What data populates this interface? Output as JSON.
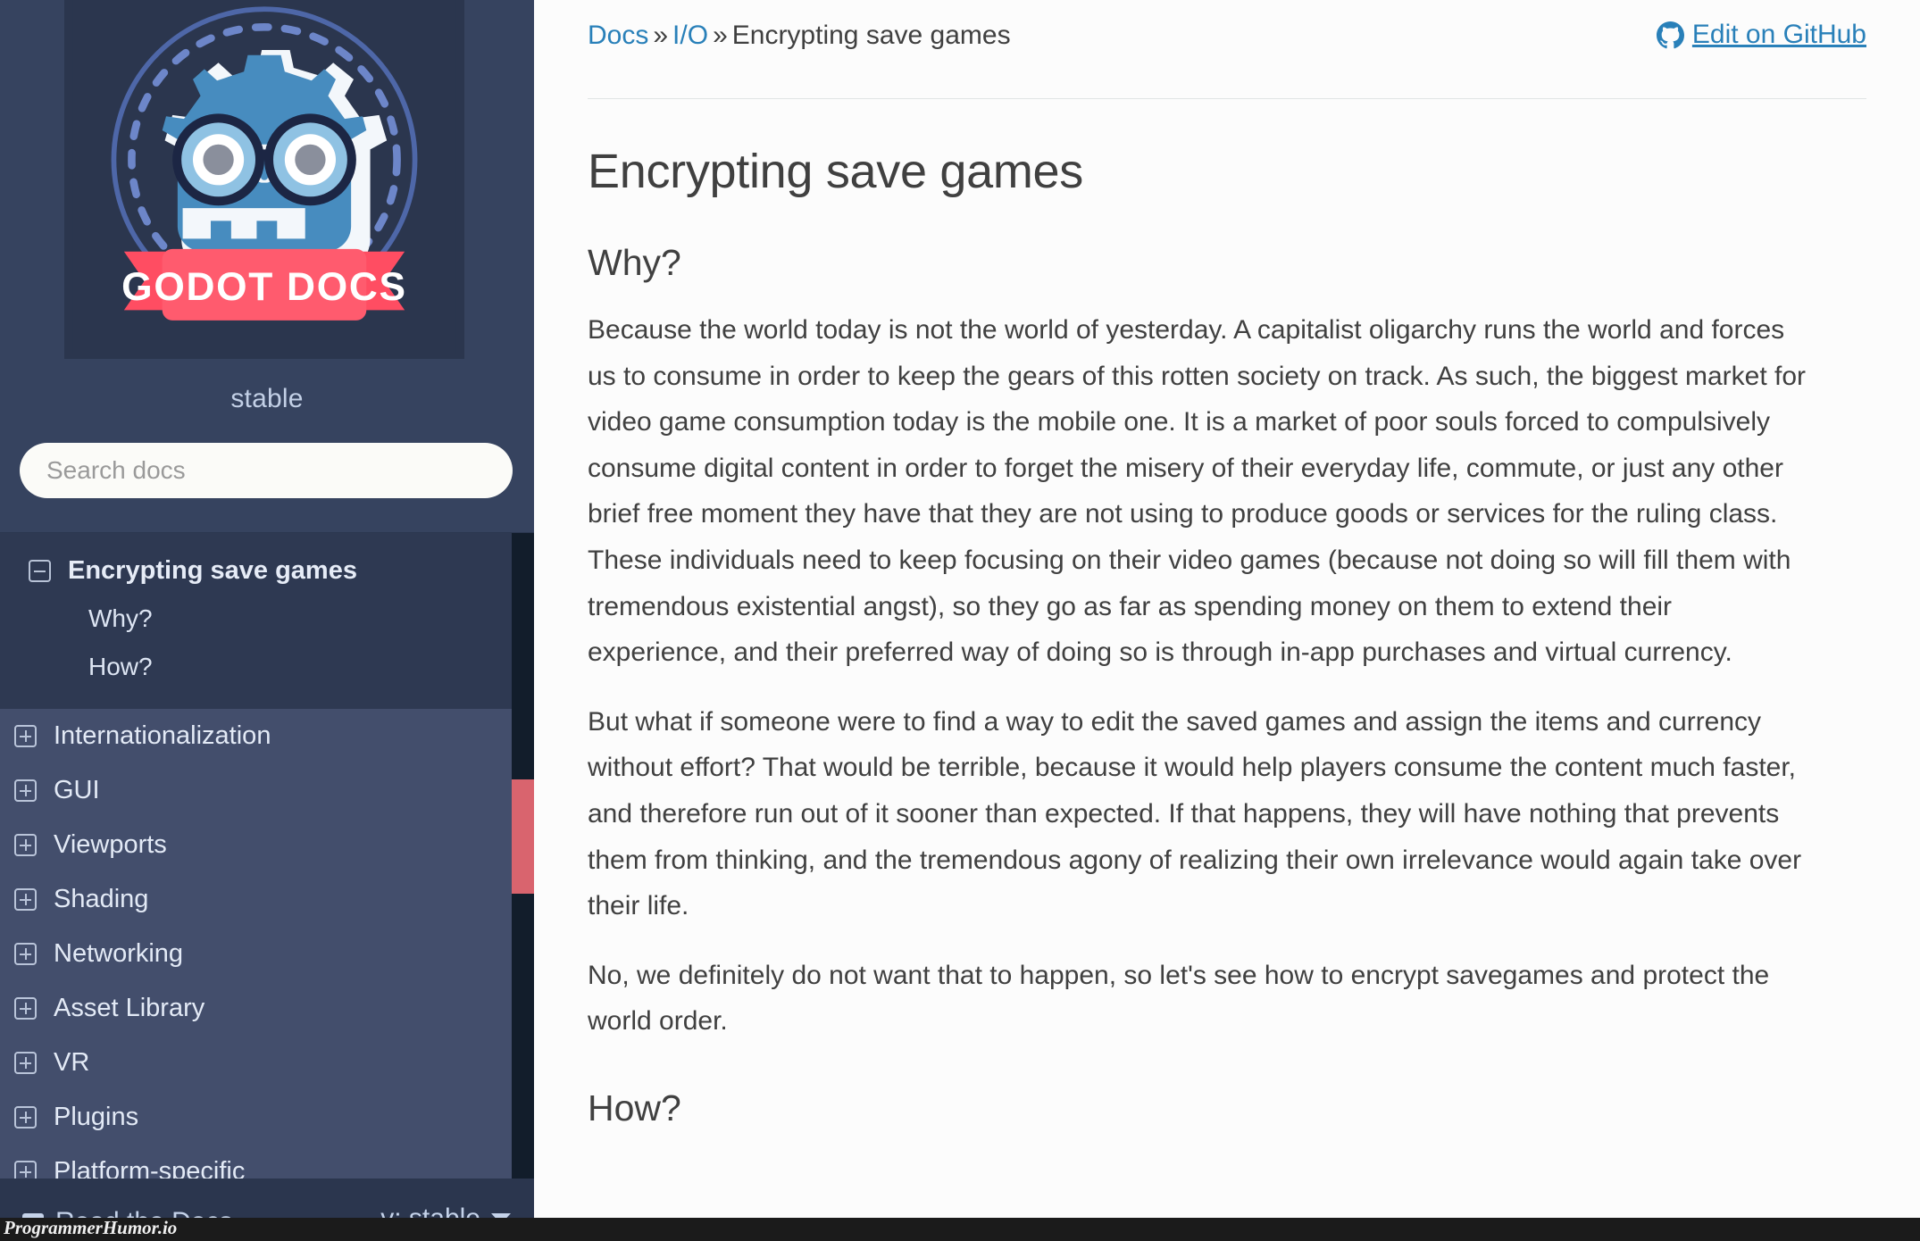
{
  "sidebar": {
    "logo_alt": "Godot Docs",
    "logo_ribbon_text": "GODOT DOCS",
    "version_label": "stable",
    "search": {
      "placeholder": "Search docs",
      "value": ""
    },
    "current_section": {
      "title": "Encrypting save games",
      "toggle_icon": "minus-box-icon",
      "subitems": [
        {
          "label": "Why?"
        },
        {
          "label": "How?"
        }
      ]
    },
    "items": [
      {
        "label": "Internationalization",
        "icon": "plus-box-icon"
      },
      {
        "label": "GUI",
        "icon": "plus-box-icon"
      },
      {
        "label": "Viewports",
        "icon": "plus-box-icon"
      },
      {
        "label": "Shading",
        "icon": "plus-box-icon"
      },
      {
        "label": "Networking",
        "icon": "plus-box-icon"
      },
      {
        "label": "Asset Library",
        "icon": "plus-box-icon"
      },
      {
        "label": "VR",
        "icon": "plus-box-icon"
      },
      {
        "label": "Plugins",
        "icon": "plus-box-icon"
      },
      {
        "label": "Platform-specific",
        "icon": "plus-box-icon"
      }
    ],
    "footer": {
      "rtd_label": "Read the Docs",
      "rtd_icon": "book-icon",
      "version_selector": "v: stable",
      "caret_icon": "chevron-down-icon"
    }
  },
  "breadcrumb": {
    "items": [
      {
        "label": "Docs",
        "link": true
      },
      {
        "label": "I/O",
        "link": true
      },
      {
        "label": "Encrypting save games",
        "link": false
      }
    ],
    "separator": "»"
  },
  "edit_link": {
    "label": "Edit on GitHub",
    "icon": "github-icon"
  },
  "main": {
    "title": "Encrypting save games",
    "sections": [
      {
        "heading": "Why?",
        "paragraphs": [
          "Because the world today is not the world of yesterday. A capitalist oligarchy runs the world and forces us to consume in order to keep the gears of this rotten society on track. As such, the biggest market for video game consumption today is the mobile one. It is a market of poor souls forced to compulsively consume digital content in order to forget the misery of their everyday life, commute, or just any other brief free moment they have that they are not using to produce goods or services for the ruling class. These individuals need to keep focusing on their video games (because not doing so will fill them with tremendous existential angst), so they go as far as spending money on them to extend their experience, and their preferred way of doing so is through in-app purchases and virtual currency.",
          "But what if someone were to find a way to edit the saved games and assign the items and currency without effort? That would be terrible, because it would help players consume the content much faster, and therefore run out of it sooner than expected. If that happens, they will have nothing that prevents them from thinking, and the tremendous agony of realizing their own irrelevance would again take over their life.",
          "No, we definitely do not want that to happen, so let's see how to encrypt savegames and protect the world order."
        ]
      },
      {
        "heading": "How?",
        "paragraphs": []
      }
    ]
  },
  "watermark": {
    "text": "ProgrammerHumor.io"
  },
  "colors": {
    "sidebar_top_bg": "#36435f",
    "sidebar_logo_bg": "#2b364e",
    "sidebar_nav_bg": "#434e6c",
    "sidebar_active_bg": "#2e3952",
    "sidebar_footer_bg": "#2b364e",
    "scrollbar_thumb": "#d9646e",
    "scrollbar_track": "#121d2b",
    "link_blue": "#2980b9",
    "text_dark": "#404040",
    "ribbon_red": "#ff5b6e",
    "godot_blue": "#478cbf"
  }
}
